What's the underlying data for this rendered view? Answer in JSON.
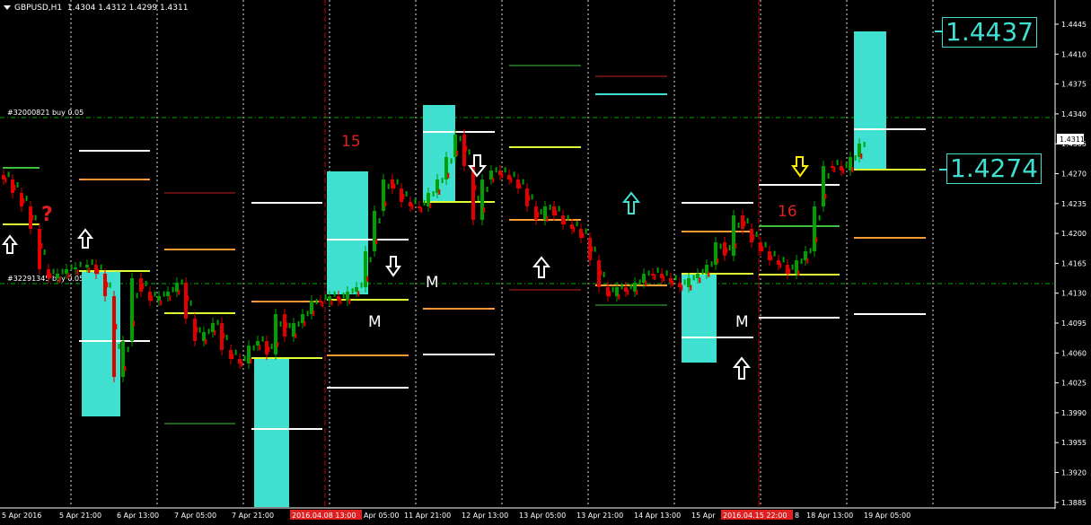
{
  "header": {
    "symbol": "GBPUSD,H1",
    "ohlc": "1.4304 1.4312 1.4299 1.4311"
  },
  "price_axis": {
    "labels": [
      "1.4445",
      "1.4410",
      "1.4375",
      "1.4340",
      "1.4305",
      "1.4270",
      "1.4235",
      "1.4200",
      "1.4165",
      "1.4130",
      "1.4095",
      "1.4060",
      "1.4025",
      "1.3990",
      "1.3955",
      "1.3920",
      "1.3885"
    ],
    "current": "1.4311"
  },
  "time_axis": {
    "labels": [
      "5 Apr 2016",
      "5 Apr 21:00",
      "6 Apr 13:00",
      "7 Apr 05:00",
      "7 Apr 21:00",
      "11 Apr 21:00",
      "12 Apr 13:00",
      "13 Apr 05:00",
      "13 Apr 21:00",
      "14 Apr 13:00",
      "15 Apr",
      "18 Apr 13:00",
      "19 Apr 05:00"
    ],
    "hl1": "2016.04.08 13:00",
    "hl1_tail": "Apr 05:00",
    "hl2": "2016.04.15 22:00",
    "hl2_tail": "8"
  },
  "price_boxes": {
    "top": "1.4437",
    "bottom": "1.4274"
  },
  "chart_labels": {
    "qmark": "?",
    "n15": "15",
    "n16": "16",
    "m": "M",
    "order1": "#32000821 buy 0.05",
    "order2": "#32291345 buy 0.05"
  },
  "colors": {
    "aqua": "#40E0D0",
    "bull": "#00A000",
    "bear": "#E00000",
    "grid": "#FFFFFF",
    "tf_line": "#00C000"
  }
}
